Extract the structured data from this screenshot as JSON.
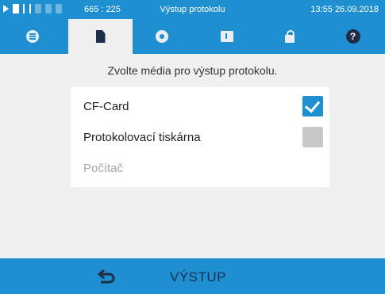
{
  "statusbar": {
    "icons": [
      "play-icon",
      "file-icon",
      "heating-icon",
      "graph-icon",
      "info-icon",
      "lock-icon"
    ],
    "counter": "665 : 225",
    "title": "Výstup protokolu",
    "time": "13:55",
    "date": "26.09.2018"
  },
  "tabs": [
    {
      "icon": "list-icon",
      "active": false
    },
    {
      "icon": "document-icon",
      "active": true
    },
    {
      "icon": "gear-icon",
      "active": false
    },
    {
      "icon": "folder-icon",
      "active": false
    },
    {
      "icon": "lock-icon",
      "active": false
    },
    {
      "icon": "help-icon",
      "active": false,
      "glyph": "?"
    }
  ],
  "main": {
    "prompt": "Zvolte média pro výstup protokolu.",
    "options": [
      {
        "label": "CF-Card",
        "checked": true,
        "enabled": true
      },
      {
        "label": "Protokolovací tiskárna",
        "checked": false,
        "enabled": true
      },
      {
        "label": "Počítač",
        "checked": null,
        "enabled": false
      }
    ]
  },
  "bottom": {
    "back_icon": "back-arrow-icon",
    "label": "VÝSTUP"
  },
  "colors": {
    "accent": "#1e8fd0",
    "dark": "#1f2d4a",
    "background": "#f0f0f0",
    "panel": "#ffffff",
    "disabled_text": "#a6a6a6"
  }
}
